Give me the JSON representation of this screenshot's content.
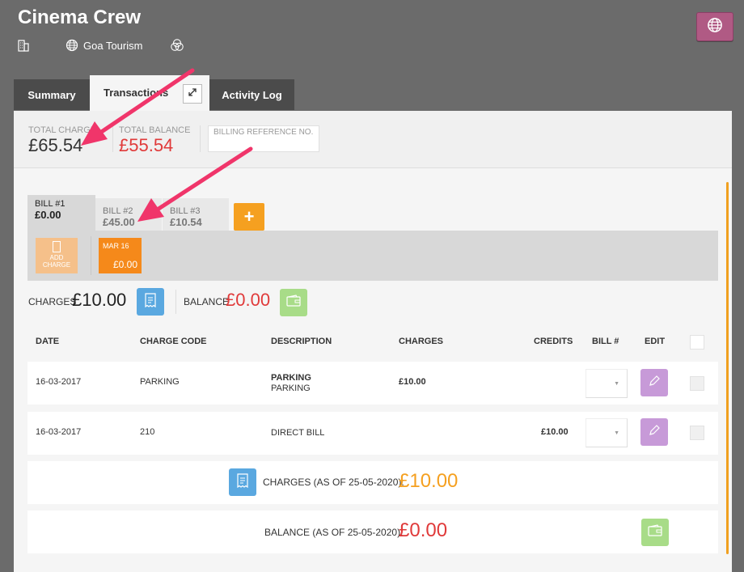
{
  "header": {
    "title": "Cinema Crew",
    "location": "Goa Tourism"
  },
  "tabs": [
    {
      "label": "Summary"
    },
    {
      "label": "Transactions"
    },
    {
      "label": "Activity Log"
    }
  ],
  "summary": {
    "total_charge_label": "TOTAL CHARGE",
    "total_charge_value": "£65.54",
    "total_balance_label": "TOTAL BALANCE",
    "total_balance_value": "£55.54",
    "billing_reference_label": "BILLING REFERENCE NO."
  },
  "bills": [
    {
      "label": "BILL #1",
      "amount": "£0.00"
    },
    {
      "label": "BILL #2",
      "amount": "£45.00"
    },
    {
      "label": "BILL #3",
      "amount": "£10.54"
    }
  ],
  "add_bill_label": "+",
  "add_charge_label_1": "ADD",
  "add_charge_label_2": "CHARGE",
  "charge_card": {
    "date": "MAR 16",
    "amount": "£0.00"
  },
  "bill_summary": {
    "charges_label": "CHARGES",
    "charges_value": "£10.00",
    "balance_label": "BALANCE",
    "balance_value": "£0.00"
  },
  "table": {
    "columns": {
      "date": "DATE",
      "charge_code": "CHARGE CODE",
      "description": "DESCRIPTION",
      "charges": "CHARGES",
      "credits": "CREDITS",
      "bill": "BILL #",
      "edit": "EDIT"
    },
    "rows": [
      {
        "date": "16-03-2017",
        "charge_code": "PARKING",
        "description": "PARKING",
        "description_sub": "PARKING",
        "charges": "£10.00",
        "credits": ""
      },
      {
        "date": "16-03-2017",
        "charge_code": "210",
        "description": "DIRECT BILL",
        "description_sub": "",
        "charges": "",
        "credits": "£10.00"
      }
    ]
  },
  "footer": {
    "charges_label": "CHARGES (AS OF 25-05-2020):",
    "charges_value": "£10.00",
    "balance_label": "BALANCE (AS OF 25-05-2020):",
    "balance_value": "£0.00"
  },
  "colors": {
    "accent_orange": "#f5a020",
    "balance_red": "#e03a3a",
    "annotation_arrow": "#f0356a"
  }
}
